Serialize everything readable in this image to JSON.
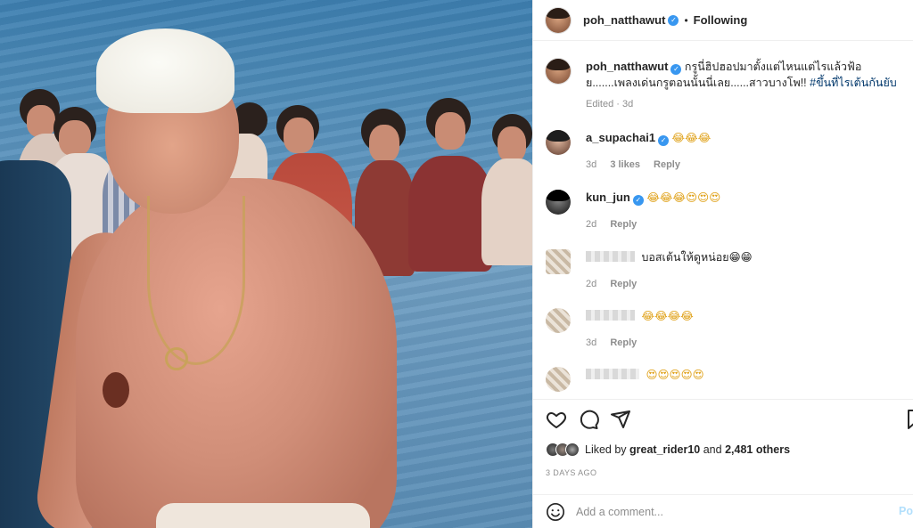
{
  "post": {
    "username": "poh_natthawut",
    "follow_status": "Following",
    "separator": "•"
  },
  "caption": {
    "username": "poh_natthawut",
    "text_part1": "กรูนี่ฮิปฮอปมาตั้งแต่ไหนแต่ไรแล้วฟ้อย.......เพลงเด่นกรูตอนนั้นนี่เลย......สาวบางโพ!! ",
    "hashtag": "#ขึ้นที่ไรเต้นกันยับ",
    "edited": "Edited · 3d"
  },
  "comments": [
    {
      "username": "a_supachai1",
      "verified": true,
      "text": "😂😂😂",
      "age": "3d",
      "likes": "3 likes",
      "reply": "Reply"
    },
    {
      "username": "kun_jun",
      "verified": true,
      "text": "😂😂😂😍😍😍",
      "age": "2d",
      "reply": "Reply"
    },
    {
      "username": "",
      "text": "บอสเต้นให้ดูหน่อย😁😁",
      "age": "2d",
      "reply": "Reply"
    },
    {
      "username": "",
      "text": "😂😂😂😂",
      "age": "3d",
      "reply": "Reply"
    },
    {
      "username": "",
      "text": "😍😍😍😍😍"
    }
  ],
  "likes": {
    "prefix": "Liked by ",
    "user": "great_rider10",
    "middle": " and ",
    "count": "2,481 others"
  },
  "timestamp": "3 DAYS AGO",
  "add_comment": {
    "placeholder": "Add a comment...",
    "post_label": "Po"
  },
  "icons": [
    "heart-icon",
    "comment-icon",
    "share-icon",
    "bookmark-icon",
    "emoji-icon",
    "verified-icon"
  ],
  "colors": {
    "verified": "#3897f0",
    "hashtag": "#00376b",
    "muted": "#8e8e8e",
    "post_button": "#b2dffc"
  }
}
